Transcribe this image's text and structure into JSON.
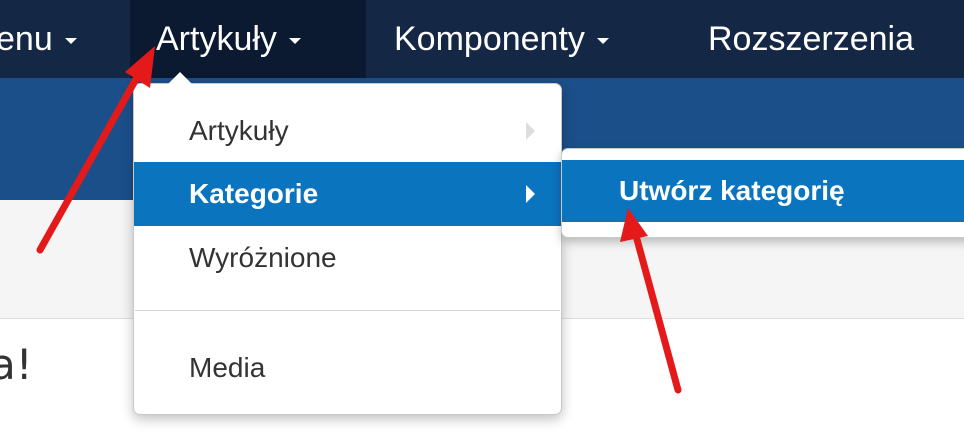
{
  "topnav": {
    "items": [
      {
        "label": "enu",
        "active": false
      },
      {
        "label": "Artykuły",
        "active": true
      },
      {
        "label": "Komponenty",
        "active": false
      },
      {
        "label": "Rozszerzenia",
        "active": false
      }
    ]
  },
  "dropdown": {
    "items": [
      {
        "label": "Artykuły",
        "has_submenu": true,
        "active": false
      },
      {
        "label": "Kategorie",
        "has_submenu": true,
        "active": true
      },
      {
        "label": "Wyróżnione",
        "has_submenu": false,
        "active": false
      },
      {
        "label": "Media",
        "has_submenu": false,
        "active": false
      }
    ]
  },
  "submenu": {
    "items": [
      {
        "label": "Utwórz kategorię",
        "active": true
      }
    ]
  },
  "content": {
    "heading_fragment": "a!"
  },
  "colors": {
    "nav_background": "#142846",
    "subbar_background": "#1b4f8a",
    "highlight": "#0a74bf",
    "annotation_arrow": "#e41a1a"
  }
}
